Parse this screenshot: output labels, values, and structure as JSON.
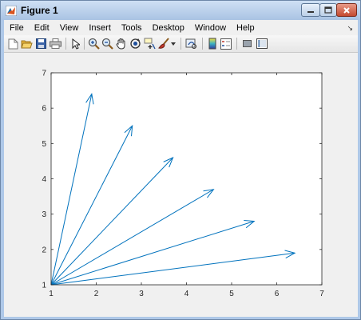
{
  "window": {
    "title": "Figure 1"
  },
  "menubar": {
    "items": [
      "File",
      "Edit",
      "View",
      "Insert",
      "Tools",
      "Desktop",
      "Window",
      "Help"
    ]
  },
  "toolbar": {
    "icons": [
      "new-figure-icon",
      "open-file-icon",
      "save-icon",
      "print-icon",
      "select-arrow-icon",
      "zoom-in-icon",
      "zoom-out-icon",
      "pan-hand-icon",
      "rotate-3d-icon",
      "data-cursor-icon",
      "brush-icon",
      "brush-dropdown-icon",
      "link-plot-icon",
      "colorbar-icon",
      "legend-icon",
      "hide-plot-tools-icon",
      "show-plot-tools-icon"
    ]
  },
  "chart_data": {
    "type": "quiver",
    "title": "",
    "xlabel": "",
    "ylabel": "",
    "xlim": [
      1,
      7
    ],
    "ylim": [
      1,
      7
    ],
    "x_ticks": [
      "1",
      "2",
      "3",
      "4",
      "5",
      "6",
      "7"
    ],
    "y_ticks": [
      "1",
      "2",
      "3",
      "4",
      "5",
      "6",
      "7"
    ],
    "grid": false,
    "box": true,
    "color": "#0072bd",
    "arrows": [
      {
        "x": 1,
        "y": 1,
        "u": 0.9,
        "v": 5.4
      },
      {
        "x": 1,
        "y": 1,
        "u": 1.8,
        "v": 4.5
      },
      {
        "x": 1,
        "y": 1,
        "u": 2.7,
        "v": 3.6
      },
      {
        "x": 1,
        "y": 1,
        "u": 3.6,
        "v": 2.7
      },
      {
        "x": 1,
        "y": 1,
        "u": 4.5,
        "v": 1.8
      },
      {
        "x": 1,
        "y": 1,
        "u": 5.4,
        "v": 0.9
      }
    ]
  }
}
